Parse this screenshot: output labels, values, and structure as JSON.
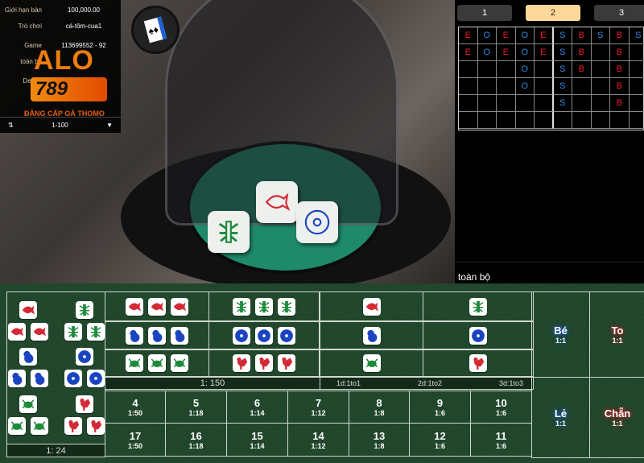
{
  "info": {
    "rows": [
      {
        "label": "Giới hạn bàn",
        "value": "100,000.00"
      },
      {
        "label": "Trò chơi",
        "value": "cá-tôm-cua1"
      },
      {
        "label": "Game",
        "value": "113699552 - 92"
      },
      {
        "label": "toàn bộ",
        "value": ""
      },
      {
        "label": "Dealer",
        "value": ""
      }
    ],
    "range": "1-100",
    "sort_icon": "sort-icon",
    "dropdown_icon": "chevron-down-icon"
  },
  "logo": {
    "text": "ALO",
    "number": "789",
    "slogan": "ĐẲNG CẤP GÀ THOMO"
  },
  "video": {
    "dice": [
      "shrimp",
      "fish",
      "coin"
    ]
  },
  "roadmap": {
    "tabs": [
      "1",
      "2",
      "3"
    ],
    "active_tab": "2",
    "colors": {
      "E": "#e8192c",
      "O": "#2b8be0",
      "S": "#2b8be0",
      "B": "#e8192c"
    },
    "columns": [
      [
        "E",
        "E"
      ],
      [
        "O",
        "O"
      ],
      [
        "E",
        "E"
      ],
      [
        "O",
        "O",
        "O",
        "O"
      ],
      [
        "E",
        "E"
      ],
      [
        "S",
        "S",
        "S",
        "S",
        "S"
      ],
      [
        "B",
        "B",
        "B"
      ],
      [
        "S"
      ],
      [
        "B",
        "B",
        "B",
        "B",
        "B"
      ],
      [
        "S"
      ]
    ],
    "filter_label": "toàn bộ"
  },
  "symbol_colors": {
    "fish": "#d42a35",
    "shrimp": "#1e8a3c",
    "gourd": "#1b45c0",
    "coin": "#1b45c0",
    "crab": "#1e8a3c",
    "rooster": "#d42a35"
  },
  "board": {
    "any_triple": {
      "groups": [
        [
          "fish",
          "shrimp"
        ],
        [
          "gourd",
          "coin"
        ],
        [
          "crab",
          "rooster"
        ]
      ],
      "odds": "1: 24"
    },
    "specific_triples": [
      [
        "fish",
        "shrimp"
      ],
      [
        "gourd",
        "coin"
      ],
      [
        "crab",
        "rooster"
      ]
    ],
    "triple_odds": "1: 150",
    "singles": [
      [
        "fish",
        "shrimp"
      ],
      [
        "gourd",
        "coin"
      ],
      [
        "crab",
        "rooster"
      ]
    ],
    "single_odds": [
      "1d:1to1",
      "2d:1to2",
      "3d:1to3"
    ],
    "totals": [
      [
        {
          "n": "4",
          "o": "1:50"
        },
        {
          "n": "5",
          "o": "1:18"
        },
        {
          "n": "6",
          "o": "1:14"
        },
        {
          "n": "7",
          "o": "1:12"
        },
        {
          "n": "8",
          "o": "1:8"
        },
        {
          "n": "9",
          "o": "1:6"
        },
        {
          "n": "10",
          "o": "1:6"
        }
      ],
      [
        {
          "n": "17",
          "o": "1:50"
        },
        {
          "n": "16",
          "o": "1:18"
        },
        {
          "n": "15",
          "o": "1:14"
        },
        {
          "n": "14",
          "o": "1:12"
        },
        {
          "n": "13",
          "o": "1:8"
        },
        {
          "n": "12",
          "o": "1:6"
        },
        {
          "n": "11",
          "o": "1:6"
        }
      ]
    ],
    "big_small": [
      {
        "label": "Bé",
        "odds": "1:1",
        "color": "#1a5bd0"
      },
      {
        "label": "To",
        "odds": "1:1",
        "color": "#c41a22"
      },
      {
        "label": "Lẻ",
        "odds": "1:1",
        "color": "#1a5bd0"
      },
      {
        "label": "Chẵn",
        "odds": "1:1",
        "color": "#c41a22"
      }
    ]
  }
}
